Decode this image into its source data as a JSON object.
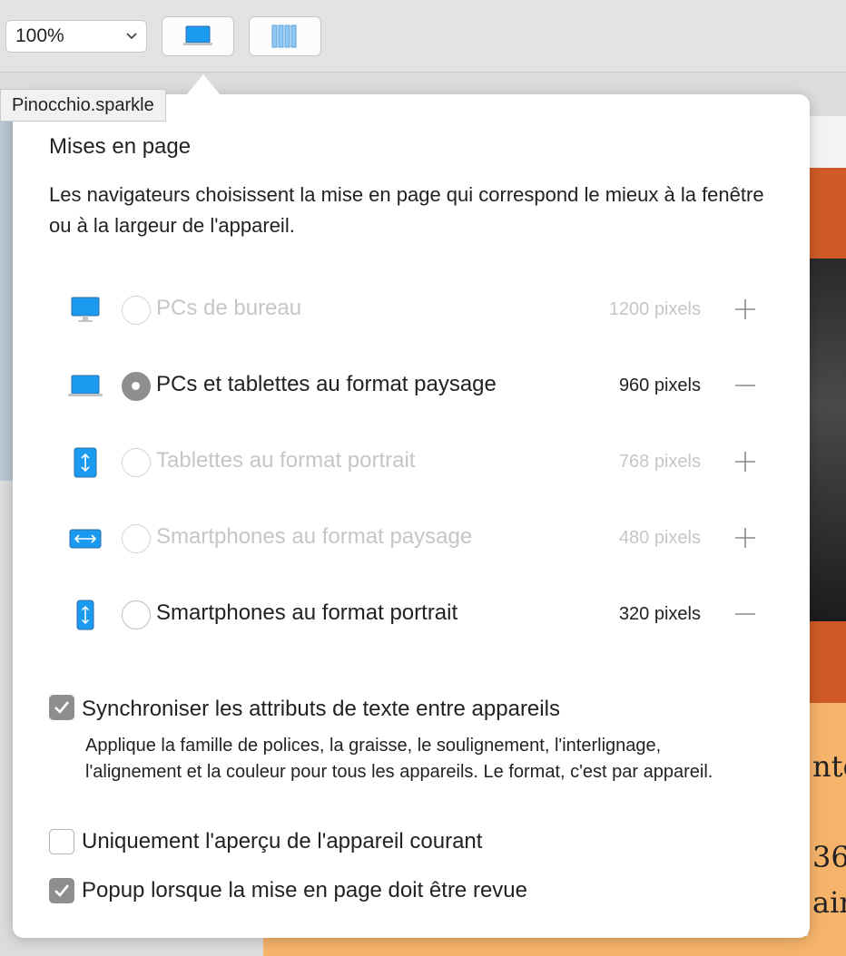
{
  "toolbar": {
    "zoom_value": "100%"
  },
  "tooltip": {
    "text": "Pinocchio.sparkle"
  },
  "popover": {
    "title": "Mises en page",
    "description": "Les navigateurs choisissent la mise en page qui correspond le mieux à la fenêtre ou à la largeur de l'appareil.",
    "layouts": [
      {
        "label": "PCs de bureau",
        "pixels": "1200 pixels",
        "enabled": false,
        "selected": false,
        "action": "plus"
      },
      {
        "label": "PCs et tablettes au format paysage",
        "pixels": "960 pixels",
        "enabled": true,
        "selected": true,
        "action": "minus"
      },
      {
        "label": "Tablettes au format portrait",
        "pixels": "768 pixels",
        "enabled": false,
        "selected": false,
        "action": "plus"
      },
      {
        "label": "Smartphones au format paysage",
        "pixels": "480 pixels",
        "enabled": false,
        "selected": false,
        "action": "plus"
      },
      {
        "label": "Smartphones au format portrait",
        "pixels": "320 pixels",
        "enabled": true,
        "selected": false,
        "action": "minus"
      }
    ],
    "options": [
      {
        "label": "Synchroniser les attributs de texte entre appareils",
        "checked": true,
        "description": "Applique la famille de polices, la graisse, le soulignement, l'interlignage, l'alignement et la couleur pour tous les appareils. Le format, c'est par appareil."
      },
      {
        "label": "Uniquement l'aperçu de l'appareil courant",
        "checked": false
      },
      {
        "label": "Popup lorsque la mise en page doit être revue",
        "checked": true
      }
    ]
  },
  "background_peek": {
    "line1": "nte",
    "line2": "36",
    "line3": "aine"
  },
  "colors": {
    "device_icon_blue": "#1a9bf0",
    "accent_orange": "#cf5a28",
    "peach": "#f6b46a"
  }
}
